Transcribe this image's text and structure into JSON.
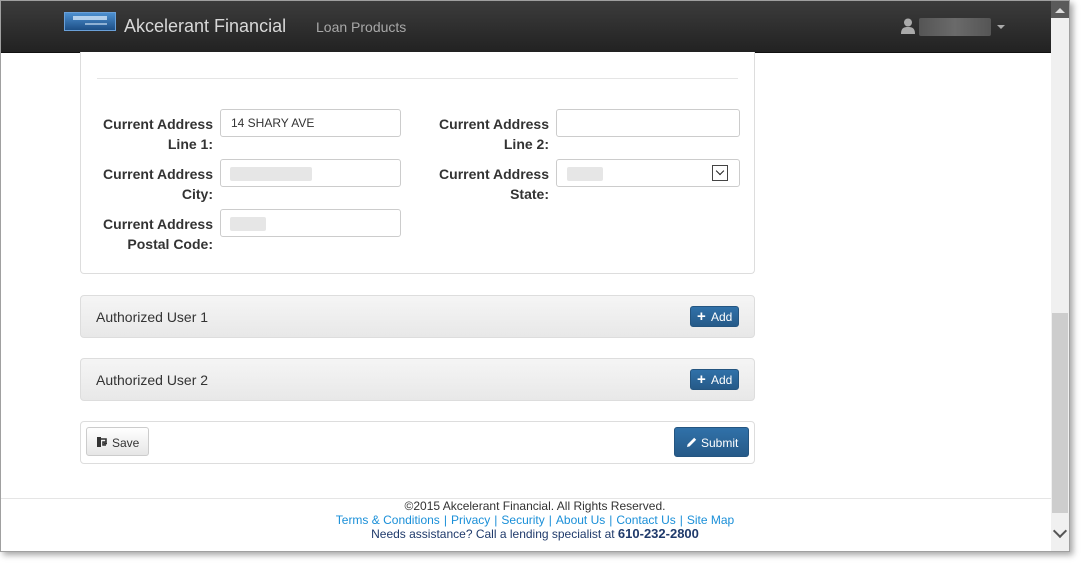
{
  "navbar": {
    "brand": "Akcelerant Financial",
    "nav_item": "Loan Products",
    "user_icon": "user-icon",
    "user_name": ""
  },
  "address": {
    "line1_label_a": "Current Address",
    "line1_label_b": "Line 1:",
    "line1_value": "14 SHARY AVE",
    "line2_label_a": "Current Address",
    "line2_label_b": "Line 2:",
    "line2_value": "",
    "city_label_a": "Current Address",
    "city_label_b": "City:",
    "city_value": "",
    "state_label_a": "Current Address",
    "state_label_b": "State:",
    "state_value": "",
    "postal_label_a": "Current Address",
    "postal_label_b": "Postal Code:",
    "postal_value": ""
  },
  "authorized_users": [
    {
      "title": "Authorized User 1",
      "add_label": "Add"
    },
    {
      "title": "Authorized User 2",
      "add_label": "Add"
    }
  ],
  "actions": {
    "save_label": "Save",
    "submit_label": "Submit"
  },
  "footer": {
    "copyright": "©2015 Akcelerant Financial. All Rights Reserved.",
    "links": [
      "Terms & Conditions",
      "Privacy",
      "Security",
      "About Us",
      "Contact Us",
      "Site Map"
    ],
    "help_text": "Needs assistance? Call a lending specialist at",
    "phone": "610-232-2800"
  },
  "colors": {
    "navbar_bg": "#222222",
    "primary_button": "#286090",
    "link": "#1a8fd8"
  }
}
